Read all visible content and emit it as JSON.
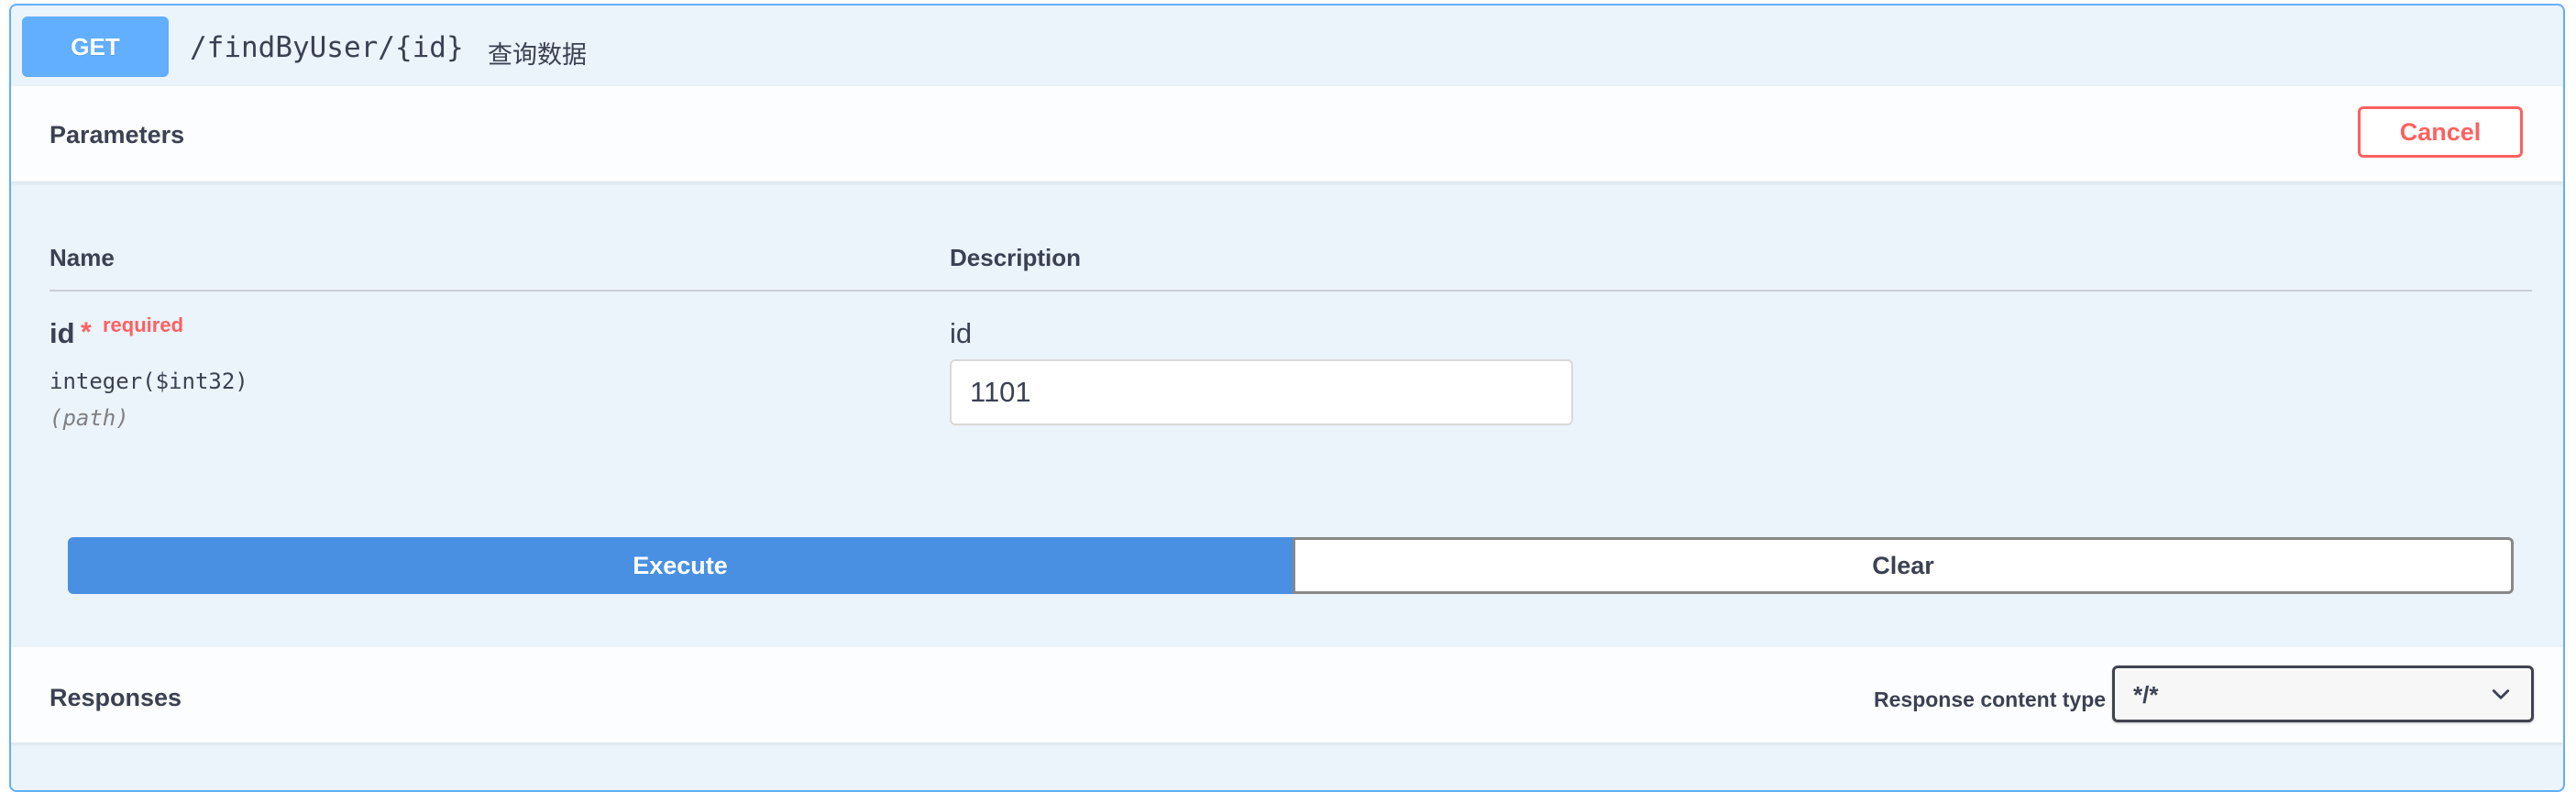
{
  "operation": {
    "method": "GET",
    "path": "/findByUser/{id}",
    "summary": "查询数据"
  },
  "parameters": {
    "title": "Parameters",
    "cancel_label": "Cancel",
    "columns": {
      "name": "Name",
      "description": "Description"
    },
    "items": [
      {
        "name": "id",
        "required_mark": "*",
        "required_label": "required",
        "type": "integer($int32)",
        "location": "(path)",
        "description": "id",
        "value": "1101"
      }
    ]
  },
  "actions": {
    "execute_label": "Execute",
    "clear_label": "Clear"
  },
  "responses": {
    "title": "Responses",
    "content_type_label": "Response content type",
    "content_type_value": "*/*"
  },
  "colors": {
    "get_accent": "#61affe",
    "execute_bg": "#4990e2",
    "cancel_red": "#ff6060",
    "block_bg": "#ebf3fb"
  },
  "icons": {
    "select_chevron": "chevron-down-icon"
  }
}
